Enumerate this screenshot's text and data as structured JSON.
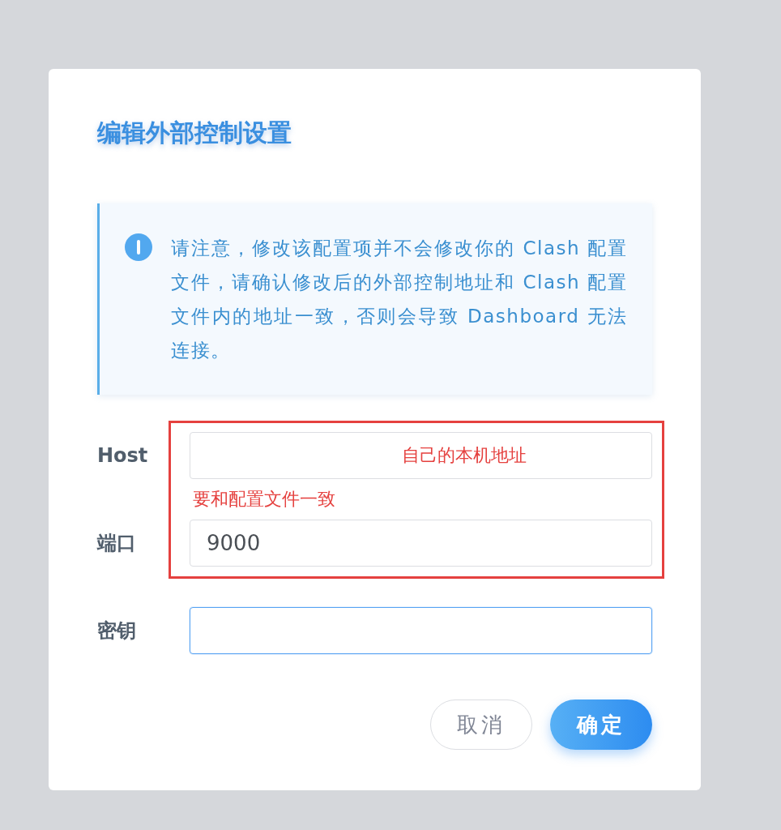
{
  "dialog": {
    "title": "编辑外部控制设置",
    "notice": {
      "text": "请注意，修改该配置项并不会修改你的 Clash 配置文件，请确认修改后的外部控制地址和 Clash 配置文件内的地址一致，否则会导致 Dashboard 无法连接。"
    },
    "fields": [
      {
        "label": "Host",
        "focused": false
      },
      {
        "label": "端口",
        "value": "9000",
        "focused": false
      },
      {
        "label": "密钥",
        "focused": true
      }
    ],
    "buttons": [
      {
        "label": "取消",
        "kind": "secondary"
      },
      {
        "label": "确定",
        "kind": "primary"
      }
    ]
  },
  "annotations": [
    {
      "text": "自己的本机地址"
    },
    {
      "text": "要和配置文件一致"
    }
  ]
}
